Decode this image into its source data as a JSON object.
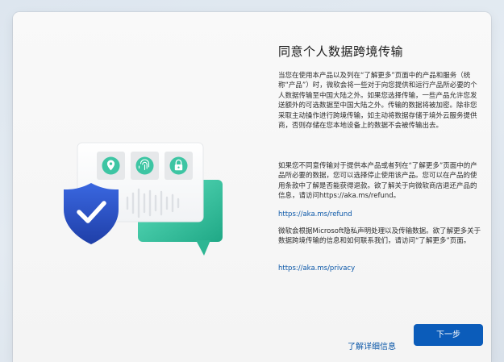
{
  "dialog": {
    "title": "同意个人数据跨境传输",
    "paragraphs": [
      "当您在使用本产品以及列在“了解更多”页面中的产品和服务（统称“产品”）时，微软会将一些对于向您提供和运行产品所必要的个人数据传输至中国大陆之外。如果您选择传输，一些产品允许您发送额外的可选数据至中国大陆之外。传输的数据将被加密。除非您采取主动操作进行跨境传输，如主动将数据存储于境外云服务提供商，否则存储在您本地设备上的数据不会被传输出去。",
      "如果您不同意传输对于提供本产品或者列在“了解更多”页面中的产品所必要的数据，您可以选择停止使用该产品。您可以在产品的使用条款中了解是否能获得退款。欲了解关于向微软商店退还产品的信息，请访问https://aka.ms/refund。",
      "微软会根据Microsoft隐私声明处理以及传输数据。欲了解更多关于数据跨境传输的信息和如何联系我们，请访问“了解更多”页面。"
    ],
    "links": [
      "https://aka.ms/refund",
      "https://aka.ms/privacy"
    ],
    "learn_more_label": "了解详细信息",
    "next_label": "下一步"
  },
  "illustration": {
    "icons": [
      "location-pin-icon",
      "fingerprint-icon",
      "lock-icon",
      "shield-check-icon",
      "chat-bubble-icon",
      "sound-wave-icon"
    ]
  },
  "colors": {
    "accent": "#0b5cba",
    "link": "#0b57a8",
    "teal": "#3fc8a6",
    "shield": "#2f55cf"
  }
}
